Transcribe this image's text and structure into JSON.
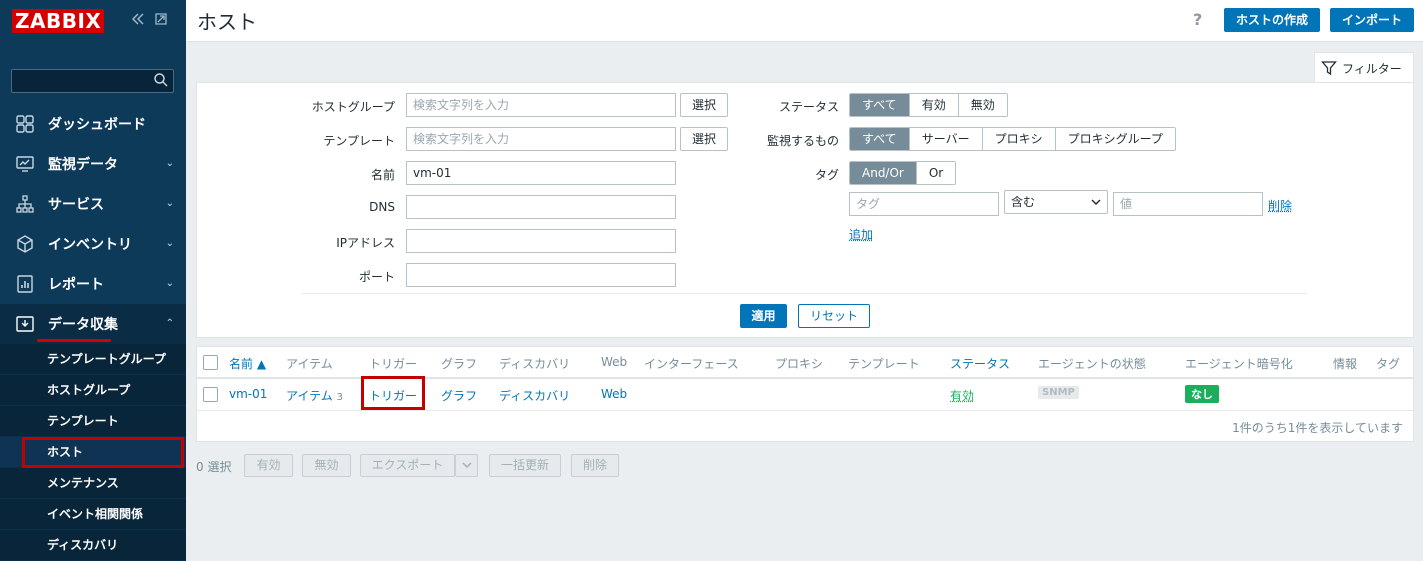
{
  "app": {
    "logo": "ZABBIX"
  },
  "sidebar": {
    "menu": [
      {
        "label": "ダッシュボード",
        "icon": "dashboard-icon",
        "chevron": false
      },
      {
        "label": "監視データ",
        "icon": "monitoring-icon",
        "chevron": true
      },
      {
        "label": "サービス",
        "icon": "services-icon",
        "chevron": true
      },
      {
        "label": "インベントリ",
        "icon": "inventory-icon",
        "chevron": true
      },
      {
        "label": "レポート",
        "icon": "reports-icon",
        "chevron": true
      },
      {
        "label": "データ収集",
        "icon": "data-collection-icon",
        "chevron": true,
        "open": true
      }
    ],
    "submenu": [
      "テンプレートグループ",
      "ホストグループ",
      "テンプレート",
      "ホスト",
      "メンテナンス",
      "イベント相関関係",
      "ディスカバリ"
    ]
  },
  "header": {
    "title": "ホスト",
    "help": "?",
    "create_host": "ホストの作成",
    "import": "インポート"
  },
  "filter": {
    "tab_label": "フィルター",
    "host_groups_label": "ホストグループ",
    "host_groups_placeholder": "検索文字列を入力",
    "templates_label": "テンプレート",
    "templates_placeholder": "検索文字列を入力",
    "select": "選択",
    "name_label": "名前",
    "name_value": "vm-01",
    "dns_label": "DNS",
    "ip_label": "IPアドレス",
    "port_label": "ポート",
    "status_label": "ステータス",
    "status_options": [
      "すべて",
      "有効",
      "無効"
    ],
    "monitored_by_label": "監視するもの",
    "monitored_by_options": [
      "すべて",
      "サーバー",
      "プロキシ",
      "プロキシグループ"
    ],
    "tags_label": "タグ",
    "tags_options": [
      "And/Or",
      "Or"
    ],
    "tag_placeholder": "タグ",
    "tag_operator": "含む",
    "value_placeholder": "値",
    "remove": "削除",
    "add": "追加",
    "apply": "適用",
    "reset": "リセット"
  },
  "table": {
    "headers": [
      "名前 ▲",
      "アイテム",
      "トリガー",
      "グラフ",
      "ディスカバリ",
      "Web",
      "インターフェース",
      "プロキシ",
      "テンプレート",
      "ステータス",
      "エージェントの状態",
      "エージェント暗号化",
      "情報",
      "タグ"
    ],
    "row": {
      "name": "vm-01",
      "items": "アイテム",
      "items_count": "3",
      "triggers": "トリガー",
      "graphs": "グラフ",
      "discovery": "ディスカバリ",
      "web": "Web",
      "status": "有効",
      "agent": "SNMP",
      "encryption": "なし"
    },
    "count_text": "1件のうち1件を表示しています"
  },
  "actions": {
    "selected": "0 選択",
    "enable": "有効",
    "disable": "無効",
    "export": "エクスポート",
    "mass_update": "一括更新",
    "delete": "削除"
  },
  "colors": {
    "sidebar_bg": "#0e3a5a",
    "accent": "#0275b8",
    "highlight": "#c40000",
    "status_green": "#1aaf5d"
  }
}
